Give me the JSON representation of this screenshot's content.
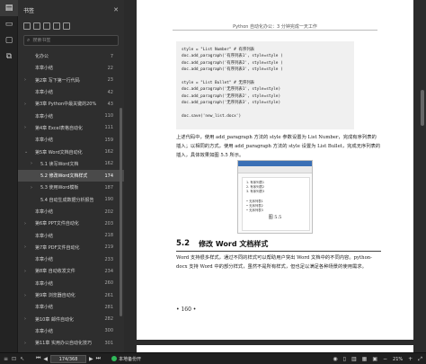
{
  "sidebar": {
    "title": "书签",
    "search_placeholder": "搜索书签",
    "items": [
      {
        "label": "化办公",
        "page": "",
        "level": 1,
        "caret": ""
      },
      {
        "label": "本章小结",
        "page": "",
        "level": 1,
        "caret": ""
      },
      {
        "label": "第2章 写下第一行代码",
        "page": "",
        "level": 1,
        "caret": "›"
      },
      {
        "label": "本章小结",
        "page": "",
        "level": 1,
        "caret": ""
      },
      {
        "label": "第3章 Python中最关键的20%",
        "page": "",
        "level": 1,
        "caret": "›"
      },
      {
        "label": "本章小结",
        "page": "",
        "level": 1,
        "caret": ""
      },
      {
        "label": "第4章 Excel表格自动化",
        "page": "",
        "level": 1,
        "caret": "›"
      },
      {
        "label": "本章小结",
        "page": "",
        "level": 1,
        "caret": ""
      },
      {
        "label": "第5章 Word文档自动化",
        "page": "",
        "level": 1,
        "caret": "⌄"
      },
      {
        "label": "5.1 读写Word文档",
        "page": "",
        "level": 2,
        "caret": "›"
      },
      {
        "label": "5.2 修改Word文档样式",
        "page": "",
        "level": 2,
        "caret": "",
        "selected": true
      },
      {
        "label": "5.3 使用Word模板",
        "page": "",
        "level": 2,
        "caret": "›"
      },
      {
        "label": "5.4 自动生成数据分析报告",
        "page": "",
        "level": 2,
        "caret": ""
      },
      {
        "label": "本章小结",
        "page": "",
        "level": 1,
        "caret": ""
      },
      {
        "label": "第6章 PPT文件自动化",
        "page": "",
        "level": 1,
        "caret": "›"
      },
      {
        "label": "本章小结",
        "page": "",
        "level": 1,
        "caret": ""
      },
      {
        "label": "第7章 PDF文件自动化",
        "page": "",
        "level": 1,
        "caret": "›"
      },
      {
        "label": "本章小结",
        "page": "",
        "level": 1,
        "caret": ""
      },
      {
        "label": "第8章 自动收发文件",
        "page": "",
        "level": 1,
        "caret": "›"
      },
      {
        "label": "本章小结",
        "page": "",
        "level": 1,
        "caret": ""
      },
      {
        "label": "第9章 浏览器自动化",
        "page": "",
        "level": 1,
        "caret": "›"
      },
      {
        "label": "本章小结",
        "page": "",
        "level": 1,
        "caret": ""
      },
      {
        "label": "第10章 邮件自动化",
        "page": "",
        "level": 1,
        "caret": "›"
      },
      {
        "label": "本章小结",
        "page": "",
        "level": 1,
        "caret": ""
      },
      {
        "label": "第11章 实用办公自动化技巧",
        "page": "",
        "level": 1,
        "caret": "›"
      }
    ],
    "page_numbers": [
      "7",
      "22",
      "23",
      "42",
      "43",
      "110",
      "111",
      "159",
      "162",
      "162",
      "174",
      "187",
      "190",
      "202",
      "203",
      "218",
      "219",
      "233",
      "234",
      "260",
      "261",
      "281",
      "282",
      "300",
      "301"
    ]
  },
  "document": {
    "running_header": "Python 自动化办公：3 分钟完成一天工作",
    "code_lines": [
      "style = \"List Number\" # 有序列表",
      "doc.add_paragraph('有序列表1', style=style )",
      "doc.add_paragraph('有序列表2', style=style )",
      "doc.add_paragraph('有序列表3', style=style )",
      "",
      "style = \"List Bullet\" # 无序列表",
      "doc.add_paragraph('无序列表1', style=style)",
      "doc.add_paragraph('无序列表2', style=style)",
      "doc.add_paragraph('无序列表3', style=style)",
      "",
      "doc.save('new_list.docx')"
    ],
    "para1": "上述代码中，使用 add_paragraph 方法的 style 参数设置为 List Number，完成有序列表的插入；以相同的方式，使用 add_paragraph 方法的 style 设置为 List Bullet，完成无序列表的插入，具体效果如图 5.5 所示。",
    "figure_lines": [
      "1. 有序列表1",
      "2. 有序列表2",
      "3. 有序列表3",
      "",
      "• 无序列表1",
      "• 无序列表2",
      "• 无序列表3"
    ],
    "figure_caption": "图 5.5",
    "section_number": "5.2",
    "section_title": "修改 Word 文档样式",
    "para2": "Word 支持很多样式，通过不同的样式可以帮助用户突出 Word 文档中的不同内容。python-docx 支持 Word 中的部分样式，虽然不是所有样式，但也足以满足各种场景的使用需求。",
    "folio": "• 160 •"
  },
  "status": {
    "page_indicator": "174/368",
    "lock_text": "本地备份开",
    "zoom": "21%"
  },
  "colors": {
    "accent": "#3a6fb5",
    "backup_dot": "#30b95a"
  }
}
